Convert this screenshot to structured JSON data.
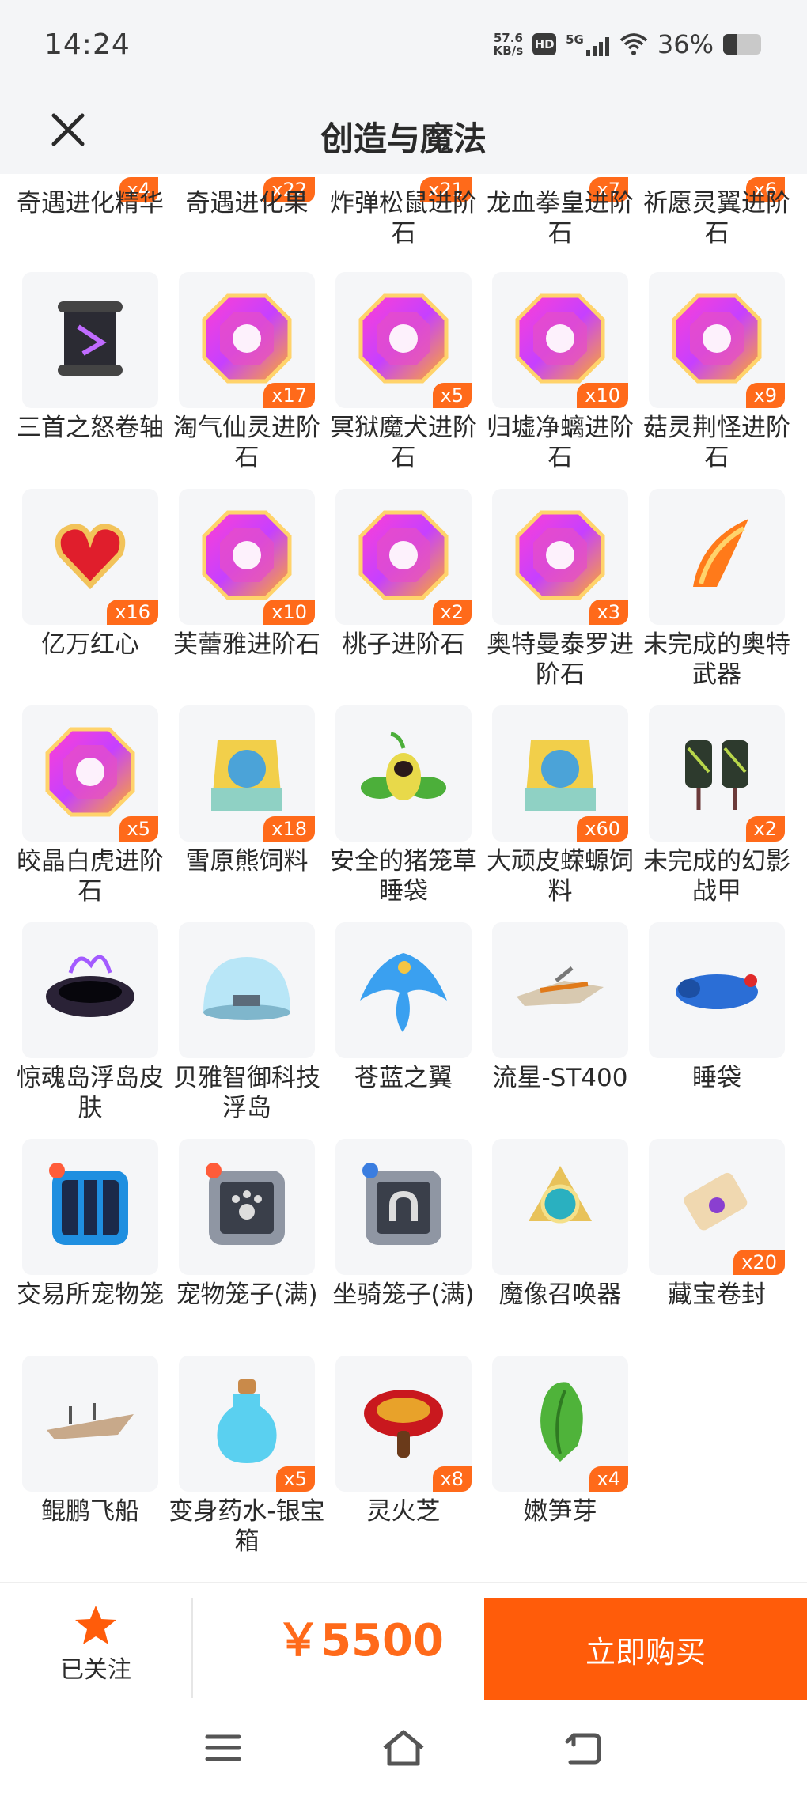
{
  "status": {
    "time": "14:24",
    "net_speed_value": "57.6",
    "net_speed_unit": "KB/s",
    "hd": "HD",
    "network": "5G",
    "battery": "36%",
    "battery_level": 0.36
  },
  "header": {
    "title": "创造与魔法",
    "close_icon": "close-icon"
  },
  "top_row": [
    {
      "name": "奇遇进化精华",
      "qty": "x4"
    },
    {
      "name": "奇遇进化果",
      "qty": "x22"
    },
    {
      "name": "炸弹松鼠进阶石",
      "qty": "x21"
    },
    {
      "name": "龙血拳皇进阶石",
      "qty": "x7"
    },
    {
      "name": "祈愿灵翼进阶石",
      "qty": "x6"
    }
  ],
  "rows": [
    [
      {
        "name": "三首之怒卷轴",
        "qty": "",
        "icon": "scroll-icon"
      },
      {
        "name": "淘气仙灵进阶石",
        "qty": "x17",
        "icon": "gem-icon"
      },
      {
        "name": "冥狱魔犬进阶石",
        "qty": "x5",
        "icon": "gem-icon"
      },
      {
        "name": "归墟净螭进阶石",
        "qty": "x10",
        "icon": "gem-icon"
      },
      {
        "name": "菇灵荆怪进阶石",
        "qty": "x9",
        "icon": "gem-icon"
      }
    ],
    [
      {
        "name": "亿万红心",
        "qty": "x16",
        "icon": "heart-icon"
      },
      {
        "name": "芙蕾雅进阶石",
        "qty": "x10",
        "icon": "gem-icon"
      },
      {
        "name": "桃子进阶石",
        "qty": "x2",
        "icon": "gem-icon"
      },
      {
        "name": "奥特曼泰罗进阶石",
        "qty": "x3",
        "icon": "gem-icon"
      },
      {
        "name": "未完成的奥特武器",
        "qty": "",
        "icon": "weapon-icon"
      }
    ],
    [
      {
        "name": "皎晶白虎进阶石",
        "qty": "x5",
        "icon": "gem-icon"
      },
      {
        "name": "雪原熊饲料",
        "qty": "x18",
        "icon": "feed-bag-icon"
      },
      {
        "name": "安全的猪笼草睡袋",
        "qty": "",
        "icon": "plant-icon"
      },
      {
        "name": "大顽皮蝾螈饲料",
        "qty": "x60",
        "icon": "feed-bag-icon"
      },
      {
        "name": "未完成的幻影战甲",
        "qty": "x2",
        "icon": "armor-icon"
      }
    ],
    [
      {
        "name": "惊魂岛浮岛皮肤",
        "qty": "",
        "icon": "island-icon"
      },
      {
        "name": "贝雅智御科技浮岛",
        "qty": "",
        "icon": "dome-icon"
      },
      {
        "name": "苍蓝之翼",
        "qty": "",
        "icon": "phoenix-icon"
      },
      {
        "name": "流星-ST400",
        "qty": "",
        "icon": "ship-icon"
      },
      {
        "name": "睡袋",
        "qty": "",
        "icon": "sleeping-bag-icon"
      }
    ],
    [
      {
        "name": "交易所宠物笼",
        "qty": "",
        "icon": "pet-cage-icon"
      },
      {
        "name": "宠物笼子(满)",
        "qty": "",
        "icon": "paw-cage-icon"
      },
      {
        "name": "坐骑笼子(满)",
        "qty": "",
        "icon": "mount-cage-icon"
      },
      {
        "name": "魔像召唤器",
        "qty": "",
        "icon": "summoner-icon"
      },
      {
        "name": "藏宝卷封",
        "qty": "x20",
        "icon": "treasure-scroll-icon"
      }
    ],
    [
      {
        "name": "鲲鹏飞船",
        "qty": "",
        "icon": "airship-icon"
      },
      {
        "name": "变身药水-银宝箱",
        "qty": "x5",
        "icon": "potion-icon"
      },
      {
        "name": "灵火芝",
        "qty": "x8",
        "icon": "mushroom-icon"
      },
      {
        "name": "嫩笋芽",
        "qty": "x4",
        "icon": "sprout-icon"
      }
    ]
  ],
  "bottom": {
    "follow_label": "已关注",
    "price": "￥5500",
    "buy_label": "立即购买"
  }
}
